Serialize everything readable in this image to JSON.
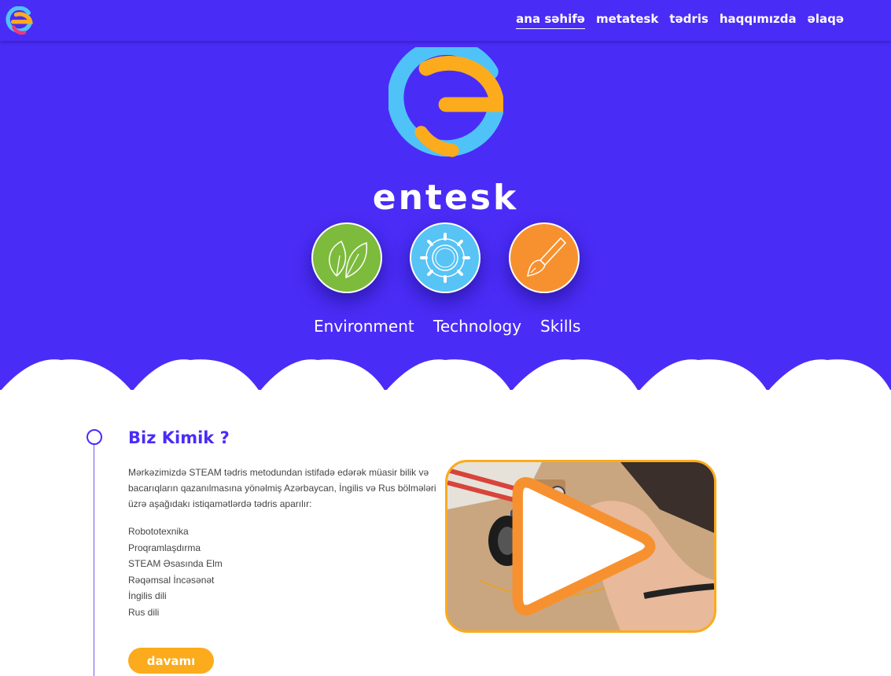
{
  "nav": {
    "items": [
      {
        "label": "ana səhifə",
        "active": true
      },
      {
        "label": "metatesk",
        "active": false
      },
      {
        "label": "tədris",
        "active": false
      },
      {
        "label": "haqqımızda",
        "active": false
      },
      {
        "label": "əlaqə",
        "active": false
      }
    ]
  },
  "hero": {
    "brand": "entesk",
    "pillars": [
      {
        "label": "Environment",
        "icon": "leaf-icon",
        "color": "#7dbb3c"
      },
      {
        "label": "Technology",
        "icon": "gear-icon",
        "color": "#58c3f5"
      },
      {
        "label": "Skills",
        "icon": "paintbrush-icon",
        "color": "#f7912f"
      }
    ]
  },
  "about": {
    "title": "Biz Kimik ?",
    "description": "Mərkəzimizdə STEAM tədris metodundan istifadə edərək müasir bilik və bacarıqların qazanılmasına yönəlmiş Azərbaycan, İngilis və Rus bölmələri üzrə aşağıdakı istiqamətlərdə tədris aparılır:",
    "directions": [
      "Robototexnika",
      "Proqramlaşdırma",
      "STEAM Əsasında Elm",
      "Rəqəmsal İncəsənət",
      "İngilis dili",
      "Rus dili"
    ],
    "more_label": "davamı"
  },
  "colors": {
    "brand_purple": "#4a2cf7",
    "accent_orange": "#fbab1c",
    "logo_blue": "#4fc3f7"
  }
}
